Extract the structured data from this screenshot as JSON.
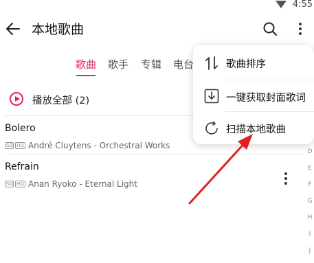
{
  "status_bar": {
    "time": "4:55"
  },
  "header": {
    "title": "本地歌曲"
  },
  "tabs": [
    {
      "label": "歌曲",
      "active": true
    },
    {
      "label": "歌手",
      "active": false
    },
    {
      "label": "专辑",
      "active": false
    },
    {
      "label": "电台",
      "active": false
    }
  ],
  "play_all": {
    "label": "播放全部 (2)"
  },
  "songs": [
    {
      "title": "Bolero",
      "badge1": "SQ",
      "badge2": "HQ",
      "artist": "André Cluytens - Orchestral Works"
    },
    {
      "title": "Refrain",
      "badge1": "SQ",
      "badge2": "HQ",
      "artist": "Anan Ryoko - Eternal Light"
    }
  ],
  "index_letters": [
    "D",
    "E",
    "F",
    "G",
    "H",
    "I",
    "J"
  ],
  "menu": {
    "items": [
      {
        "label": "歌曲排序",
        "icon": "sort-icon"
      },
      {
        "label": "一键获取封面歌词",
        "icon": "download-icon"
      },
      {
        "label": "扫描本地歌曲",
        "icon": "scan-icon"
      }
    ]
  },
  "colors": {
    "accent": "#e0216c",
    "annotation": "#e02020"
  }
}
